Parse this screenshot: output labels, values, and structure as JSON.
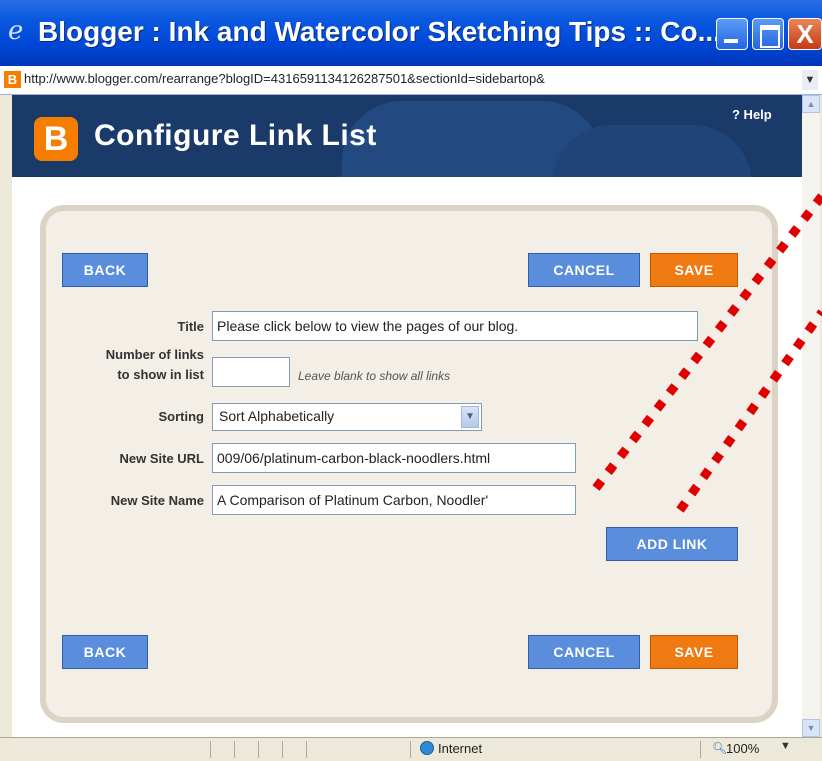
{
  "window": {
    "title": "Blogger : Ink and Watercolor Sketching Tips :: Co...",
    "controls": {
      "minimize": "minimize",
      "maximize": "maximize",
      "close": "X"
    }
  },
  "address_bar": {
    "url": "http://www.blogger.com/rearrange?blogID=4316591134126287501&sectionId=sidebartop&"
  },
  "header": {
    "logo_letter": "B",
    "title": "Configure Link List",
    "help": "? Help"
  },
  "toolbar_top": {
    "back": "BACK",
    "cancel": "CANCEL",
    "save": "SAVE"
  },
  "form": {
    "title_label": "Title",
    "title_value": "Please click below to view the pages of our blog.",
    "num_links_label_1": "Number of links",
    "num_links_label_2": "to show in list",
    "num_links_value": "",
    "num_links_hint": "Leave blank to show all links",
    "sorting_label": "Sorting",
    "sorting_value": "Sort Alphabetically",
    "new_url_label": "New Site URL",
    "new_url_value": "009/06/platinum-carbon-black-noodlers.html",
    "new_name_label": "New Site Name",
    "new_name_value": "A Comparison of Platinum Carbon, Noodler'",
    "add_link": "ADD LINK"
  },
  "toolbar_bottom": {
    "back": "BACK",
    "cancel": "CANCEL",
    "save": "SAVE"
  },
  "status_bar": {
    "zone": "Internet",
    "zoom": "100%"
  },
  "colors": {
    "titlebar": "#0046d5",
    "header": "#1a3a6a",
    "blogger_orange": "#f57d00",
    "button_blue": "#5a8ddc",
    "button_orange": "#f07a12",
    "annotation_red": "#e00000"
  },
  "icons": {
    "browser": "ie-logo-icon",
    "favicon": "blogger-favicon-icon",
    "zone": "globe-icon",
    "zoom": "magnifier-icon"
  }
}
